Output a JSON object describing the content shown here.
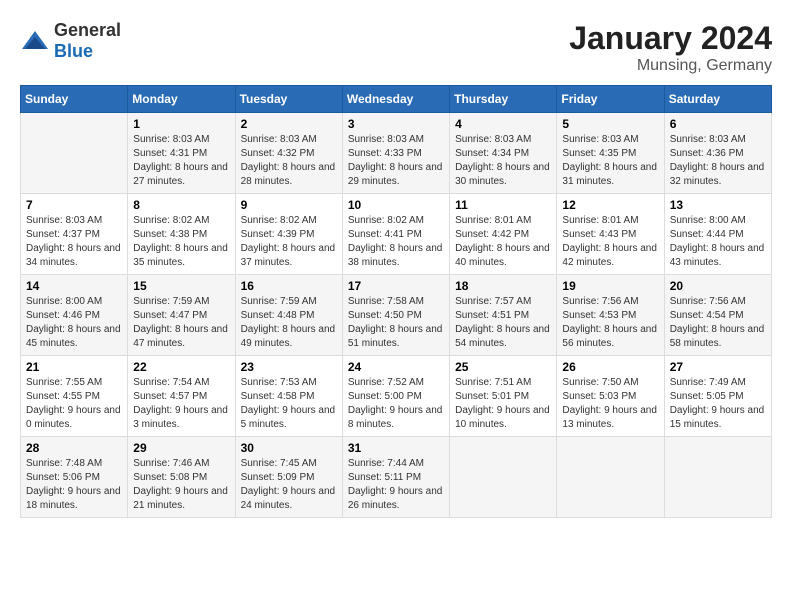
{
  "header": {
    "logo_general": "General",
    "logo_blue": "Blue",
    "month_year": "January 2024",
    "location": "Munsing, Germany"
  },
  "weekdays": [
    "Sunday",
    "Monday",
    "Tuesday",
    "Wednesday",
    "Thursday",
    "Friday",
    "Saturday"
  ],
  "weeks": [
    [
      {
        "day": "",
        "sunrise": "",
        "sunset": "",
        "daylight": ""
      },
      {
        "day": "1",
        "sunrise": "Sunrise: 8:03 AM",
        "sunset": "Sunset: 4:31 PM",
        "daylight": "Daylight: 8 hours and 27 minutes."
      },
      {
        "day": "2",
        "sunrise": "Sunrise: 8:03 AM",
        "sunset": "Sunset: 4:32 PM",
        "daylight": "Daylight: 8 hours and 28 minutes."
      },
      {
        "day": "3",
        "sunrise": "Sunrise: 8:03 AM",
        "sunset": "Sunset: 4:33 PM",
        "daylight": "Daylight: 8 hours and 29 minutes."
      },
      {
        "day": "4",
        "sunrise": "Sunrise: 8:03 AM",
        "sunset": "Sunset: 4:34 PM",
        "daylight": "Daylight: 8 hours and 30 minutes."
      },
      {
        "day": "5",
        "sunrise": "Sunrise: 8:03 AM",
        "sunset": "Sunset: 4:35 PM",
        "daylight": "Daylight: 8 hours and 31 minutes."
      },
      {
        "day": "6",
        "sunrise": "Sunrise: 8:03 AM",
        "sunset": "Sunset: 4:36 PM",
        "daylight": "Daylight: 8 hours and 32 minutes."
      }
    ],
    [
      {
        "day": "7",
        "sunrise": "Sunrise: 8:03 AM",
        "sunset": "Sunset: 4:37 PM",
        "daylight": "Daylight: 8 hours and 34 minutes."
      },
      {
        "day": "8",
        "sunrise": "Sunrise: 8:02 AM",
        "sunset": "Sunset: 4:38 PM",
        "daylight": "Daylight: 8 hours and 35 minutes."
      },
      {
        "day": "9",
        "sunrise": "Sunrise: 8:02 AM",
        "sunset": "Sunset: 4:39 PM",
        "daylight": "Daylight: 8 hours and 37 minutes."
      },
      {
        "day": "10",
        "sunrise": "Sunrise: 8:02 AM",
        "sunset": "Sunset: 4:41 PM",
        "daylight": "Daylight: 8 hours and 38 minutes."
      },
      {
        "day": "11",
        "sunrise": "Sunrise: 8:01 AM",
        "sunset": "Sunset: 4:42 PM",
        "daylight": "Daylight: 8 hours and 40 minutes."
      },
      {
        "day": "12",
        "sunrise": "Sunrise: 8:01 AM",
        "sunset": "Sunset: 4:43 PM",
        "daylight": "Daylight: 8 hours and 42 minutes."
      },
      {
        "day": "13",
        "sunrise": "Sunrise: 8:00 AM",
        "sunset": "Sunset: 4:44 PM",
        "daylight": "Daylight: 8 hours and 43 minutes."
      }
    ],
    [
      {
        "day": "14",
        "sunrise": "Sunrise: 8:00 AM",
        "sunset": "Sunset: 4:46 PM",
        "daylight": "Daylight: 8 hours and 45 minutes."
      },
      {
        "day": "15",
        "sunrise": "Sunrise: 7:59 AM",
        "sunset": "Sunset: 4:47 PM",
        "daylight": "Daylight: 8 hours and 47 minutes."
      },
      {
        "day": "16",
        "sunrise": "Sunrise: 7:59 AM",
        "sunset": "Sunset: 4:48 PM",
        "daylight": "Daylight: 8 hours and 49 minutes."
      },
      {
        "day": "17",
        "sunrise": "Sunrise: 7:58 AM",
        "sunset": "Sunset: 4:50 PM",
        "daylight": "Daylight: 8 hours and 51 minutes."
      },
      {
        "day": "18",
        "sunrise": "Sunrise: 7:57 AM",
        "sunset": "Sunset: 4:51 PM",
        "daylight": "Daylight: 8 hours and 54 minutes."
      },
      {
        "day": "19",
        "sunrise": "Sunrise: 7:56 AM",
        "sunset": "Sunset: 4:53 PM",
        "daylight": "Daylight: 8 hours and 56 minutes."
      },
      {
        "day": "20",
        "sunrise": "Sunrise: 7:56 AM",
        "sunset": "Sunset: 4:54 PM",
        "daylight": "Daylight: 8 hours and 58 minutes."
      }
    ],
    [
      {
        "day": "21",
        "sunrise": "Sunrise: 7:55 AM",
        "sunset": "Sunset: 4:55 PM",
        "daylight": "Daylight: 9 hours and 0 minutes."
      },
      {
        "day": "22",
        "sunrise": "Sunrise: 7:54 AM",
        "sunset": "Sunset: 4:57 PM",
        "daylight": "Daylight: 9 hours and 3 minutes."
      },
      {
        "day": "23",
        "sunrise": "Sunrise: 7:53 AM",
        "sunset": "Sunset: 4:58 PM",
        "daylight": "Daylight: 9 hours and 5 minutes."
      },
      {
        "day": "24",
        "sunrise": "Sunrise: 7:52 AM",
        "sunset": "Sunset: 5:00 PM",
        "daylight": "Daylight: 9 hours and 8 minutes."
      },
      {
        "day": "25",
        "sunrise": "Sunrise: 7:51 AM",
        "sunset": "Sunset: 5:01 PM",
        "daylight": "Daylight: 9 hours and 10 minutes."
      },
      {
        "day": "26",
        "sunrise": "Sunrise: 7:50 AM",
        "sunset": "Sunset: 5:03 PM",
        "daylight": "Daylight: 9 hours and 13 minutes."
      },
      {
        "day": "27",
        "sunrise": "Sunrise: 7:49 AM",
        "sunset": "Sunset: 5:05 PM",
        "daylight": "Daylight: 9 hours and 15 minutes."
      }
    ],
    [
      {
        "day": "28",
        "sunrise": "Sunrise: 7:48 AM",
        "sunset": "Sunset: 5:06 PM",
        "daylight": "Daylight: 9 hours and 18 minutes."
      },
      {
        "day": "29",
        "sunrise": "Sunrise: 7:46 AM",
        "sunset": "Sunset: 5:08 PM",
        "daylight": "Daylight: 9 hours and 21 minutes."
      },
      {
        "day": "30",
        "sunrise": "Sunrise: 7:45 AM",
        "sunset": "Sunset: 5:09 PM",
        "daylight": "Daylight: 9 hours and 24 minutes."
      },
      {
        "day": "31",
        "sunrise": "Sunrise: 7:44 AM",
        "sunset": "Sunset: 5:11 PM",
        "daylight": "Daylight: 9 hours and 26 minutes."
      },
      {
        "day": "",
        "sunrise": "",
        "sunset": "",
        "daylight": ""
      },
      {
        "day": "",
        "sunrise": "",
        "sunset": "",
        "daylight": ""
      },
      {
        "day": "",
        "sunrise": "",
        "sunset": "",
        "daylight": ""
      }
    ]
  ]
}
